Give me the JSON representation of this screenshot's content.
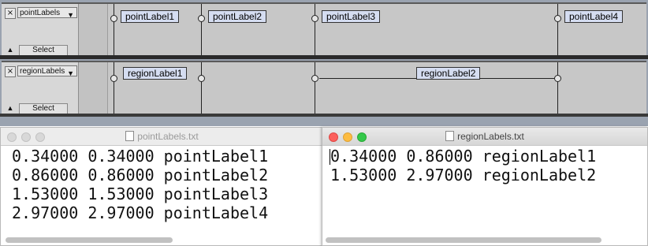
{
  "tracks": [
    {
      "name": "pointLabels",
      "close_glyph": "×",
      "dropdown_glyph": "▼",
      "collapse_glyph": "▲",
      "select_label": "Select",
      "labels": [
        "pointLabel1",
        "pointLabel2",
        "pointLabel3",
        "pointLabel4"
      ]
    },
    {
      "name": "regionLabels",
      "close_glyph": "×",
      "dropdown_glyph": "▼",
      "collapse_glyph": "▲",
      "select_label": "Select",
      "labels": [
        "regionLabel1",
        "regionLabel2"
      ]
    }
  ],
  "windows": {
    "left": {
      "title": "pointLabels.txt",
      "lines": [
        "0.34000 0.34000 pointLabel1",
        "0.86000 0.86000 pointLabel2",
        "1.53000 1.53000 pointLabel3",
        "2.97000 2.97000 pointLabel4"
      ]
    },
    "right": {
      "title": "regionLabels.txt",
      "lines": [
        "0.34000 0.86000 regionLabel1",
        "1.53000 2.97000 regionLabel2"
      ]
    }
  }
}
